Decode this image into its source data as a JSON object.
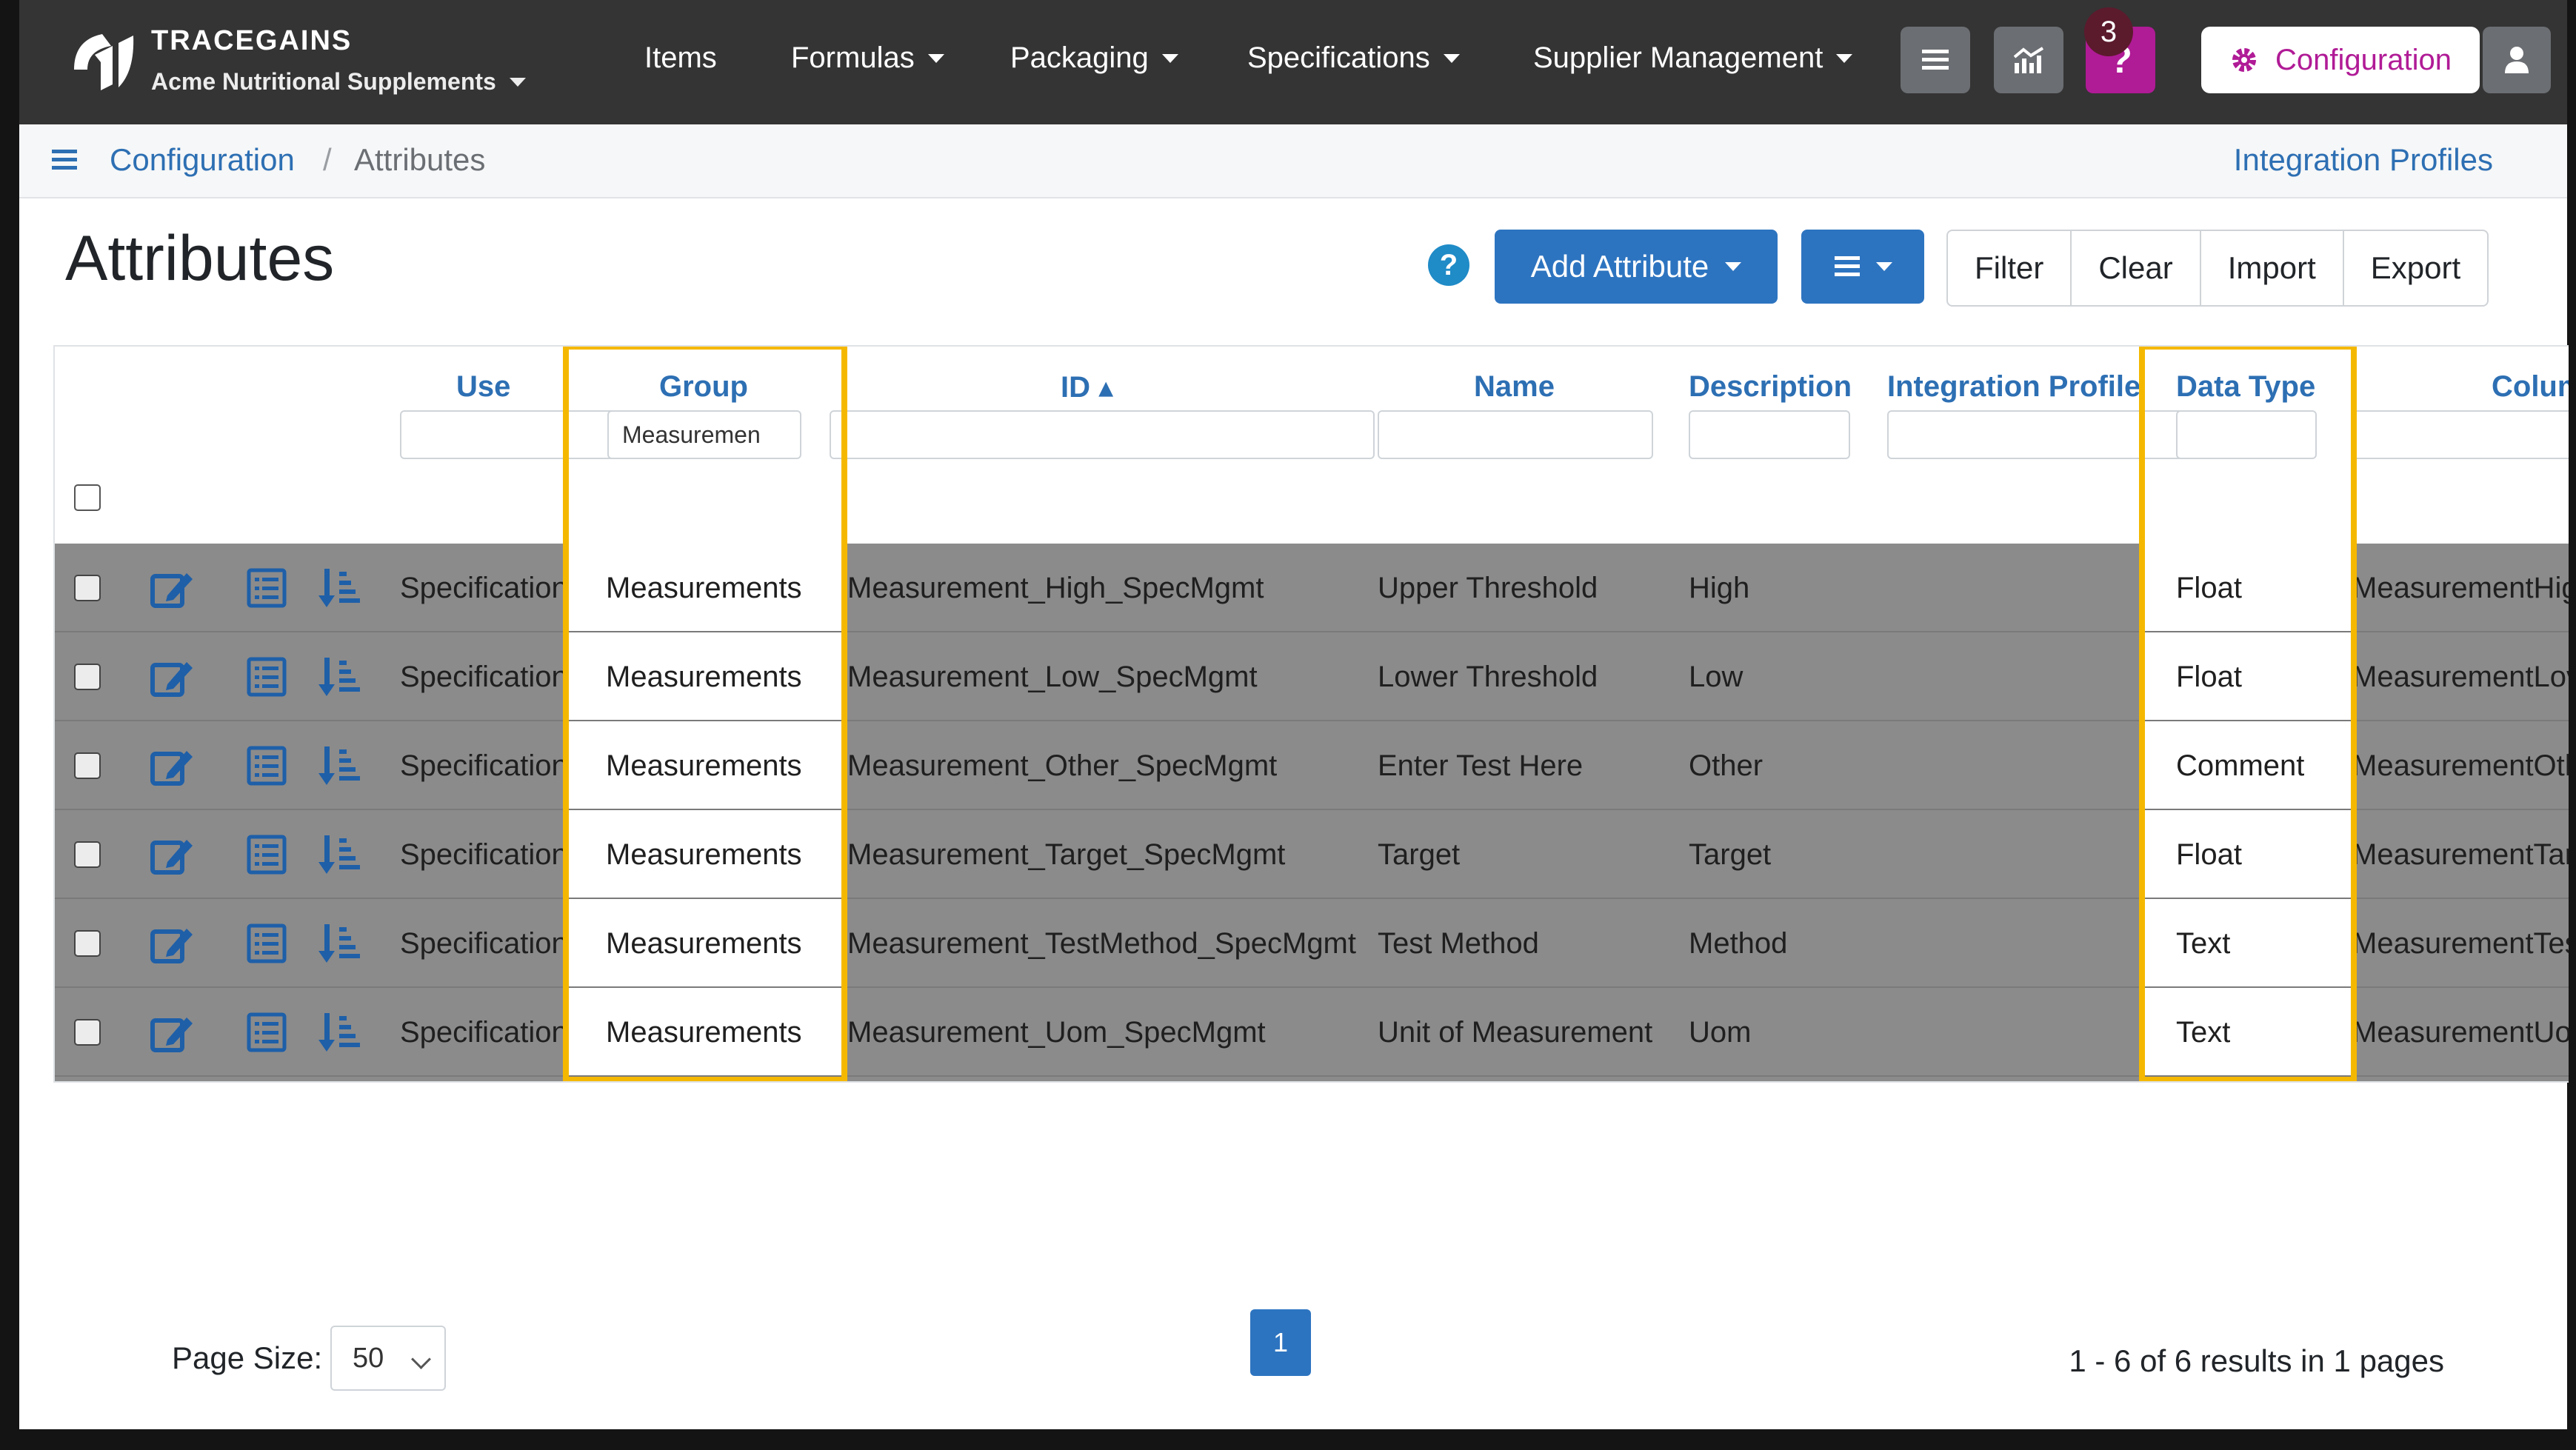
{
  "brand": {
    "name": "TRACEGAINS",
    "company": "Acme Nutritional Supplements"
  },
  "nav": {
    "items": [
      {
        "label": "Items"
      },
      {
        "label": "Formulas"
      },
      {
        "label": "Packaging"
      },
      {
        "label": "Specifications"
      },
      {
        "label": "Supplier Management"
      }
    ],
    "notification_count": "3",
    "config_label": "Configuration",
    "icons": [
      "list-icon",
      "chart-icon",
      "help-icon",
      "gear-icon",
      "user-icon"
    ]
  },
  "breadcrumb": {
    "parent": "Configuration",
    "separator": "/",
    "current": "Attributes",
    "right_link": "Integration Profiles"
  },
  "page": {
    "title": "Attributes",
    "help": "?"
  },
  "toolbar": {
    "add_attribute": "Add Attribute",
    "filter": "Filter",
    "clear": "Clear",
    "import": "Import",
    "export": "Export"
  },
  "table": {
    "headers": {
      "use": "Use",
      "group": "Group",
      "id": "ID ▴",
      "name": "Name",
      "description": "Description",
      "integration_profile": "Integration Profile",
      "data_type": "Data Type",
      "column": "Colum"
    },
    "filters": {
      "group": "Measuremen"
    },
    "rows": [
      {
        "use": "Specification",
        "group": "Measurements",
        "id": "Measurement_High_SpecMgmt",
        "name": "Upper Threshold",
        "description": "High",
        "data_type": "Float",
        "column": "MeasurementHig"
      },
      {
        "use": "Specification",
        "group": "Measurements",
        "id": "Measurement_Low_SpecMgmt",
        "name": "Lower Threshold",
        "description": "Low",
        "data_type": "Float",
        "column": "MeasurementLov"
      },
      {
        "use": "Specification",
        "group": "Measurements",
        "id": "Measurement_Other_SpecMgmt",
        "name": "Enter Test Here",
        "description": "Other",
        "data_type": "Comment",
        "column": "MeasurementOth"
      },
      {
        "use": "Specification",
        "group": "Measurements",
        "id": "Measurement_Target_SpecMgmt",
        "name": "Target",
        "description": "Target",
        "data_type": "Float",
        "column": "MeasurementTar"
      },
      {
        "use": "Specification",
        "group": "Measurements",
        "id": "Measurement_TestMethod_SpecMgmt",
        "name": "Test Method",
        "description": "Method",
        "data_type": "Text",
        "column": "MeasurementTes"
      },
      {
        "use": "Specification",
        "group": "Measurements",
        "id": "Measurement_Uom_SpecMgmt",
        "name": "Unit of Measurement",
        "description": "Uom",
        "data_type": "Text",
        "column": "MeasurementUo"
      }
    ]
  },
  "footer": {
    "page_size_label": "Page Size:",
    "page_size": "50",
    "current_page": "1",
    "results": "1 - 6 of 6 results in 1 pages"
  },
  "colors": {
    "navbar": "#343434",
    "link": "#2d6fb3",
    "primary": "#2d74c0",
    "help": "#b01b96",
    "highlight": "#f5b800"
  }
}
